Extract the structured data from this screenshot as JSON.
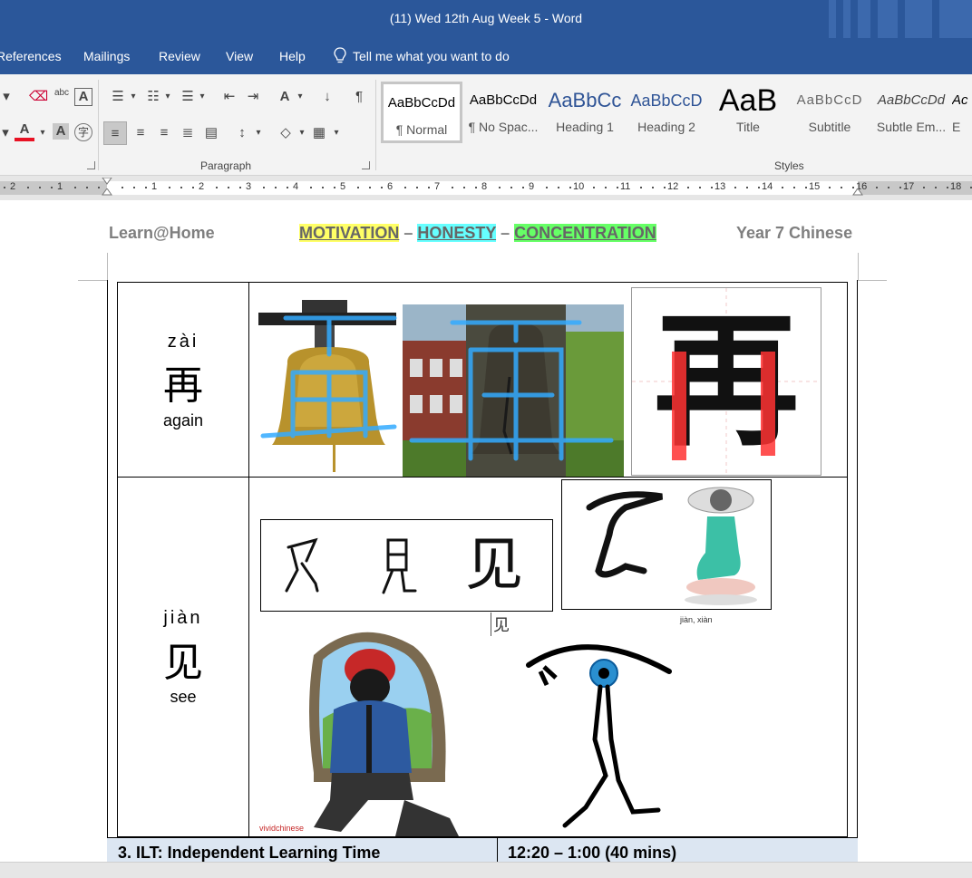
{
  "window": {
    "title": "(11) Wed 12th Aug Week 5  -  Word"
  },
  "menu": {
    "references": "References",
    "mailings": "Mailings",
    "review": "Review",
    "view": "View",
    "help": "Help",
    "tell_me": "Tell me what you want to do"
  },
  "ribbon": {
    "paragraph_label": "Paragraph",
    "styles_label": "Styles",
    "styles": [
      {
        "sample": "AaBbCcDd",
        "name": "¶ Normal"
      },
      {
        "sample": "AaBbCcDd",
        "name": "¶ No Spac..."
      },
      {
        "sample": "AaBbCc",
        "name": "Heading 1"
      },
      {
        "sample": "AaBbCcD",
        "name": "Heading 2"
      },
      {
        "sample": "AaB",
        "name": "Title"
      },
      {
        "sample": "AaBbCcD",
        "name": "Subtitle"
      },
      {
        "sample": "AaBbCcDd",
        "name": "Subtle Em..."
      },
      {
        "sample": "Ac",
        "name": "E"
      }
    ],
    "colors": {
      "font_color": "#e81123",
      "accent": "#2b579a"
    }
  },
  "ruler": {
    "left_numbers": [
      "2",
      "1"
    ],
    "right_numbers": [
      "1",
      "2",
      "3",
      "4",
      "5",
      "6",
      "7",
      "8",
      "9",
      "10",
      "11",
      "12",
      "13",
      "14",
      "15",
      "16",
      "17",
      "18"
    ]
  },
  "document": {
    "header": {
      "left": "Learn@Home",
      "motivation": "MOTIVATION",
      "dash": "–",
      "honesty": "HONESTY",
      "concentration": "CONCENTRATION",
      "right": "Year 7 Chinese"
    },
    "rows": [
      {
        "pinyin": "zài",
        "hanzi": "再",
        "meaning": "again"
      },
      {
        "pinyin": "jiàn",
        "hanzi": "见",
        "meaning": "see"
      }
    ],
    "image_text": {
      "stroke_glyph": "再",
      "evolution_glyph": "见",
      "small_glyph": "见",
      "caption_pinyin": "jiàn, xiàn",
      "watermark": "vividchinese"
    },
    "ilt_row": {
      "title": "3. ILT: Independent Learning Time",
      "time": "12:20 – 1:00 (40 mins)"
    }
  }
}
